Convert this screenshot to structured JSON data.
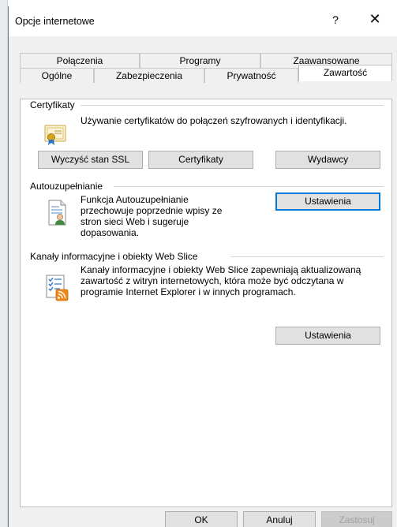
{
  "window": {
    "title": "Opcje internetowe",
    "help_glyph": "?",
    "close_glyph": "✕"
  },
  "tabs": {
    "row1": [
      {
        "label": "Połączenia"
      },
      {
        "label": "Programy"
      },
      {
        "label": "Zaawansowane"
      }
    ],
    "row2": [
      {
        "label": "Ogólne"
      },
      {
        "label": "Zabezpieczenia"
      },
      {
        "label": "Prywatność"
      },
      {
        "label": "Zawartość",
        "active": true
      }
    ]
  },
  "certificates": {
    "group_label": "Certyfikaty",
    "description": "Używanie certyfikatów do połączeń szyfrowanych i identyfikacji.",
    "buttons": {
      "clear_ssl": "Wyczyść stan SSL",
      "certificates": "Certyfikaty",
      "publishers": "Wydawcy"
    }
  },
  "autocomplete": {
    "group_label": "Autouzupełnianie",
    "description": "Funkcja Autouzupełnianie przechowuje poprzednie wpisy ze stron sieci Web i sugeruje dopasowania.",
    "settings_button": "Ustawienia"
  },
  "feeds": {
    "group_label": "Kanały informacyjne i obiekty Web Slice",
    "description": "Kanały informacyjne i obiekty Web Slice zapewniają aktualizowaną zawartość z witryn internetowych, która może być odczytana w programie Internet Explorer i w innych programach.",
    "settings_button": "Ustawienia"
  },
  "footer": {
    "ok": "OK",
    "cancel": "Anuluj",
    "apply": "Zastosuj"
  },
  "colors": {
    "focus_border": "#0078d7",
    "button_face": "#e1e1e1",
    "panel_bg": "#ffffff",
    "dialog_bg": "#f0f0f0"
  },
  "icons": {
    "certificate": "certificate-icon",
    "autocomplete": "autocomplete-icon",
    "feeds": "feeds-icon"
  }
}
